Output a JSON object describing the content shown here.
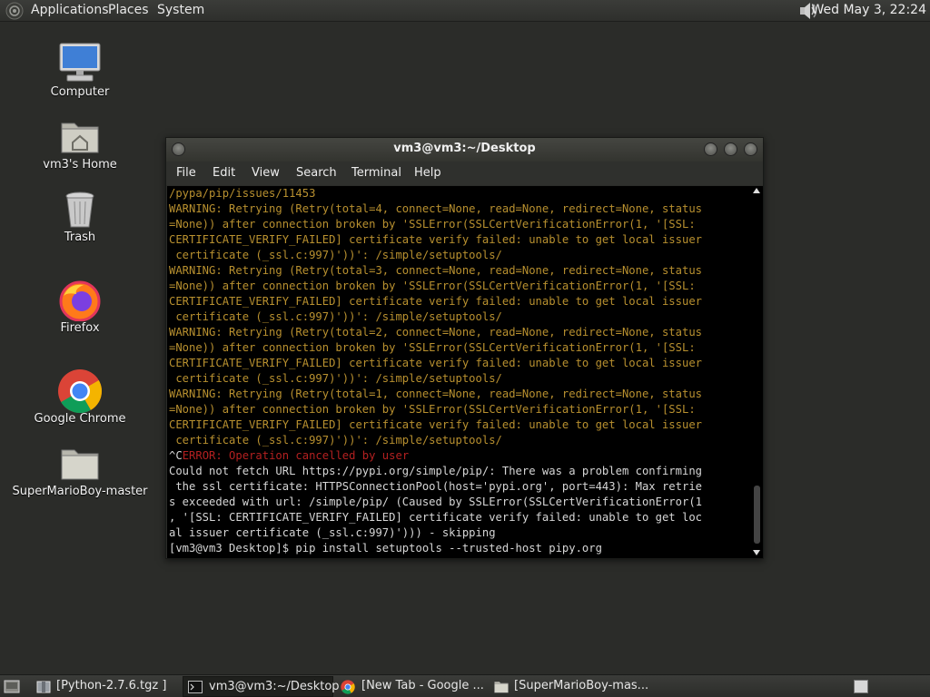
{
  "top_panel": {
    "menus": [
      "Applications",
      "Places",
      "System"
    ],
    "clock": "Wed May  3, 22:24",
    "icons": [
      "gnome-foot-icon",
      "volume-icon"
    ]
  },
  "desktop": {
    "icons": [
      {
        "label": "Computer",
        "icon": "computer-icon"
      },
      {
        "label": "vm3's Home",
        "icon": "home-folder-icon"
      },
      {
        "label": "Trash",
        "icon": "trash-icon"
      },
      {
        "label": "Firefox",
        "icon": "firefox-icon"
      },
      {
        "label": "Google Chrome",
        "icon": "chrome-icon"
      },
      {
        "label": "SuperMarioBoy-master",
        "icon": "folder-icon"
      }
    ]
  },
  "terminal": {
    "title": "vm3@vm3:~/Desktop",
    "menu": [
      "File",
      "Edit",
      "View",
      "Search",
      "Terminal",
      "Help"
    ],
    "lines": [
      {
        "text": "/pypa/pip/issues/11453",
        "style": "warn"
      },
      {
        "text": "WARNING: Retrying (Retry(total=4, connect=None, read=None, redirect=None, status",
        "style": "warn"
      },
      {
        "text": "=None)) after connection broken by 'SSLError(SSLCertVerificationError(1, '[SSL:",
        "style": "warn"
      },
      {
        "text": "CERTIFICATE_VERIFY_FAILED] certificate verify failed: unable to get local issuer",
        "style": "warn"
      },
      {
        "text": " certificate (_ssl.c:997)'))': /simple/setuptools/",
        "style": "warn"
      },
      {
        "text": "WARNING: Retrying (Retry(total=3, connect=None, read=None, redirect=None, status",
        "style": "warn"
      },
      {
        "text": "=None)) after connection broken by 'SSLError(SSLCertVerificationError(1, '[SSL:",
        "style": "warn"
      },
      {
        "text": "CERTIFICATE_VERIFY_FAILED] certificate verify failed: unable to get local issuer",
        "style": "warn"
      },
      {
        "text": " certificate (_ssl.c:997)'))': /simple/setuptools/",
        "style": "warn"
      },
      {
        "text": "WARNING: Retrying (Retry(total=2, connect=None, read=None, redirect=None, status",
        "style": "warn"
      },
      {
        "text": "=None)) after connection broken by 'SSLError(SSLCertVerificationError(1, '[SSL:",
        "style": "warn"
      },
      {
        "text": "CERTIFICATE_VERIFY_FAILED] certificate verify failed: unable to get local issuer",
        "style": "warn"
      },
      {
        "text": " certificate (_ssl.c:997)'))': /simple/setuptools/",
        "style": "warn"
      },
      {
        "text": "WARNING: Retrying (Retry(total=1, connect=None, read=None, redirect=None, status",
        "style": "warn"
      },
      {
        "text": "=None)) after connection broken by 'SSLError(SSLCertVerificationError(1, '[SSL:",
        "style": "warn"
      },
      {
        "text": "CERTIFICATE_VERIFY_FAILED] certificate verify failed: unable to get local issuer",
        "style": "warn"
      },
      {
        "text": " certificate (_ssl.c:997)'))': /simple/setuptools/",
        "style": "warn"
      },
      {
        "prefix": "^C",
        "text": "ERROR: Operation cancelled by user",
        "style": "err"
      },
      {
        "text": "Could not fetch URL https://pypi.org/simple/pip/: There was a problem confirming",
        "style": "norm"
      },
      {
        "text": " the ssl certificate: HTTPSConnectionPool(host='pypi.org', port=443): Max retrie",
        "style": "norm"
      },
      {
        "text": "s exceeded with url: /simple/pip/ (Caused by SSLError(SSLCertVerificationError(1",
        "style": "norm"
      },
      {
        "text": ", '[SSL: CERTIFICATE_VERIFY_FAILED] certificate verify failed: unable to get loc",
        "style": "norm"
      },
      {
        "text": "al issuer certificate (_ssl.c:997)'))) - skipping",
        "style": "norm"
      },
      {
        "text": "[vm3@vm3 Desktop]$ pip install setuptools --trusted-host pipy.org",
        "style": "norm"
      }
    ]
  },
  "taskbar": {
    "tasks": [
      {
        "label": "[Python-2.7.6.tgz ]",
        "icon": "archive-icon"
      },
      {
        "label": "vm3@vm3:~/Desktop",
        "icon": "terminal-icon"
      },
      {
        "label": "[New Tab - Google ...",
        "icon": "chrome-icon"
      },
      {
        "label": "[SuperMarioBoy-mas...",
        "icon": "folder-icon"
      }
    ]
  },
  "colors": {
    "desktop_bg": "#2b2c29",
    "warning_text": "#b8902f",
    "error_text": "#b32020",
    "normal_text": "#d6d6d6"
  }
}
